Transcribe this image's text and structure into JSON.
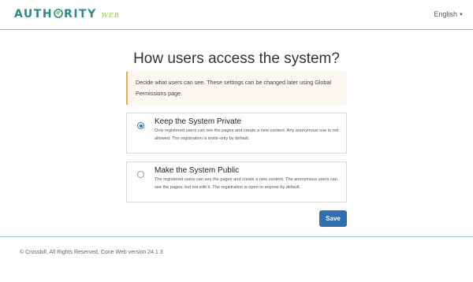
{
  "header": {
    "logo_main_left": "AUTH",
    "logo_main_right": "RITY",
    "logo_sub": "WEB",
    "language": "English",
    "colors": {
      "brand_teal": "#2a8a8a",
      "brand_green": "#8dc63f",
      "divider": "#8cc8c8"
    }
  },
  "main": {
    "title": "How users access the system?",
    "notice": "Decide what users can see. These settings can be changed later using Global Permissions page.",
    "options": [
      {
        "title": "Keep the System Private",
        "description": "Only registered users can see the pages and create a new content. Any anonymous use is not allowed. The registration is invite-only by default.",
        "selected": true
      },
      {
        "title": "Make the System Public",
        "description": "The registered users can see the pages and create a new content. The anonymous users can see the pages, but not edit it. The registration is open to anyone by default.",
        "selected": false
      }
    ],
    "save_label": "Save",
    "colors": {
      "accent": "#2f6fb0",
      "notice_border": "#f0ad4e",
      "notice_bg": "#fcf8f1"
    }
  },
  "footer": {
    "text": "© Crossbill, All Rights Reserved, Cone Web version 24.1.3"
  }
}
